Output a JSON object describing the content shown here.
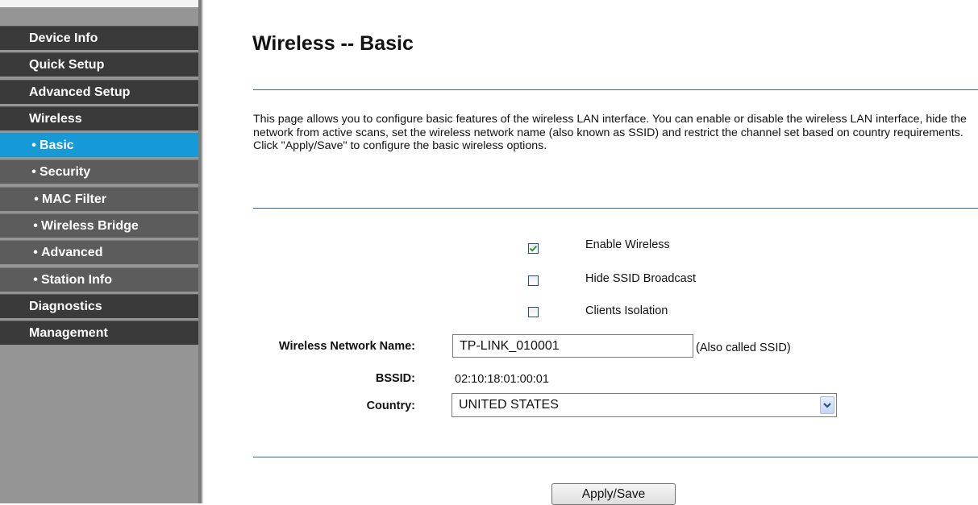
{
  "sidebar": {
    "items": [
      {
        "label": "Device Info"
      },
      {
        "label": "Quick Setup"
      },
      {
        "label": "Advanced Setup"
      },
      {
        "label": "Wireless"
      },
      {
        "label": "Basic"
      },
      {
        "label": "Security"
      },
      {
        "label": "MAC Filter"
      },
      {
        "label": "Wireless Bridge"
      },
      {
        "label": "Advanced"
      },
      {
        "label": "Station Info"
      },
      {
        "label": "Diagnostics"
      },
      {
        "label": "Management"
      }
    ],
    "bullet": "•",
    "active_item": "Basic"
  },
  "main": {
    "title": "Wireless -- Basic",
    "description_1": "This page allows you to configure basic features of the wireless LAN interface. You can enable or disable the wireless LAN interface, hide the network from active scans, set the wireless network name (also known as SSID) and restrict the channel set based on country requirements.",
    "description_2": "Click \"Apply/Save\" to configure the basic wireless options.",
    "options": [
      {
        "label": "Enable Wireless",
        "checked": true
      },
      {
        "label": "Hide SSID Broadcast",
        "checked": false
      },
      {
        "label": "Clients Isolation",
        "checked": false
      }
    ],
    "ssid": {
      "label": "Wireless Network Name:",
      "value": "TP-LINK_010001",
      "note": "(Also called SSID)"
    },
    "bssid": {
      "label": "BSSID:",
      "value": "02:10:18:01:00:01"
    },
    "country": {
      "label": "Country:",
      "value": "UNITED STATES"
    },
    "apply_label": "Apply/Save"
  },
  "colors": {
    "active_nav": "#1699d7",
    "nav_bg": "#3a3a3a",
    "sub_nav_bg": "#5c5c5c",
    "rule": "#2e6d96",
    "check": "#2f9a2f"
  },
  "icons": {
    "checkmark": "checkmark-icon",
    "dropdown": "chevron-down-icon",
    "bullet": "bullet-icon"
  }
}
